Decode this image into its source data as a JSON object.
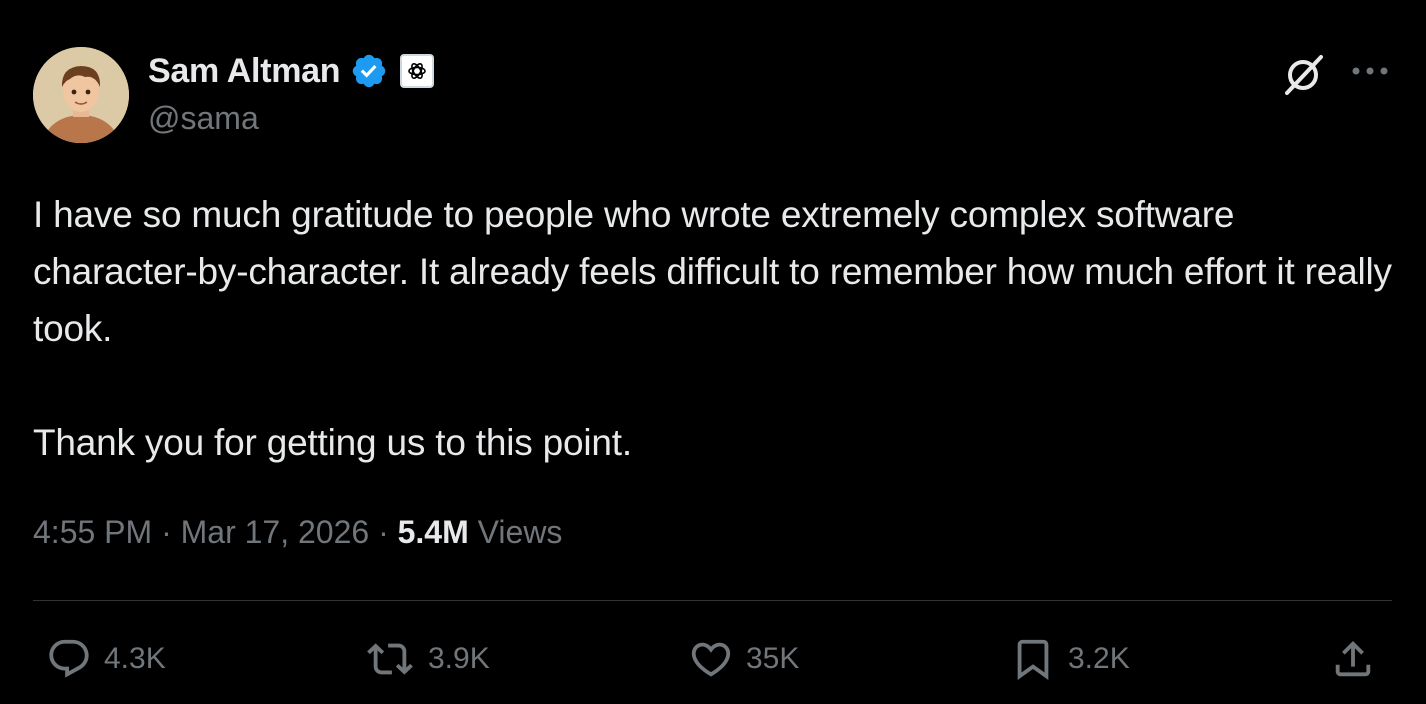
{
  "author": {
    "display_name": "Sam Altman",
    "handle": "@sama",
    "verified": true,
    "affiliation": "OpenAI"
  },
  "tweet": {
    "paragraphs": [
      "I have so much gratitude to people who wrote extremely complex software character-by-character. It already feels difficult to remember how much effort it really took.",
      "Thank you for getting us to this point."
    ],
    "time": "4:55 PM",
    "separator": "·",
    "date": "Mar 17, 2026",
    "views_count": "5.4M",
    "views_label": "Views"
  },
  "actions": {
    "replies": "4.3K",
    "reposts": "3.9K",
    "likes": "35K",
    "bookmarks": "3.2K"
  },
  "colors": {
    "background": "#000000",
    "text": "#e7e9ea",
    "secondary": "#71767b",
    "verified_blue": "#1d9bf0",
    "divider": "#2f3336"
  },
  "icons": {
    "verified": "verified-badge-icon",
    "affiliation": "openai-logo-icon",
    "grok": "grok-icon",
    "more": "more-icon",
    "reply": "reply-icon",
    "repost": "repost-icon",
    "like": "heart-icon",
    "bookmark": "bookmark-icon",
    "share": "share-icon"
  }
}
